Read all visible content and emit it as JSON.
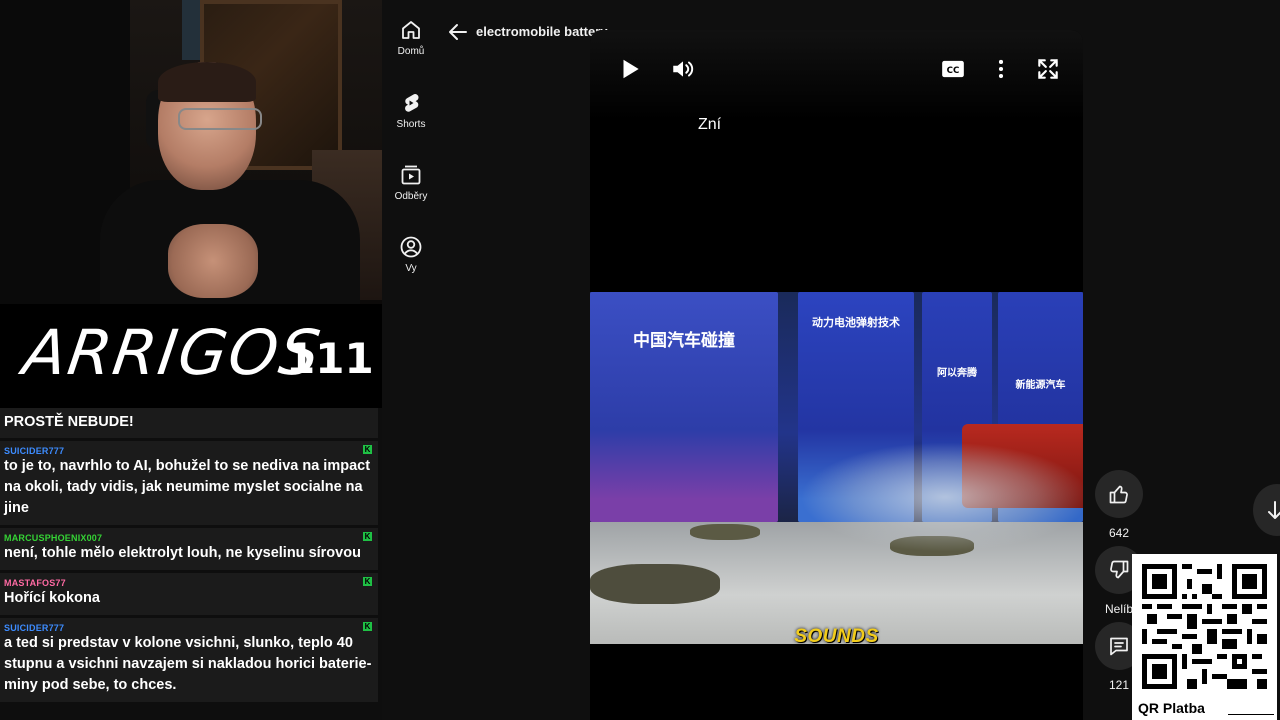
{
  "stream": {
    "brand_name": "ARRIGOS",
    "viewer_count": "111"
  },
  "chat": {
    "partial_message": "PROSTĚ NEBUDE!",
    "messages": [
      {
        "user": "SUICIDER777",
        "user_color": "#3d8cff",
        "text": "to je to, navrhlo to AI, bohužel to se nediva na impact na okoli, tady vidis, jak neumime myslet socialne na jine"
      },
      {
        "user": "MARCUSPHOENIX007",
        "user_color": "#35d335",
        "text": "není, tohle mělo elektrolyt louh, ne kyselinu sírovou"
      },
      {
        "user": "MASTAFOS77",
        "user_color": "#ff6aa3",
        "text": "Hořící kokona"
      },
      {
        "user": "SUICIDER777",
        "user_color": "#3d8cff",
        "text": "a ted si predstav v kolone vsichni, slunko, teplo 40 stupnu a vsichni navzajem si nakladou horici baterie-miny pod sebe, to chces."
      }
    ],
    "badge_icon": "kick-badge-icon",
    "badge_color": "#1fc145"
  },
  "youtube": {
    "nav": [
      {
        "label": "Domů",
        "icon": "home-icon"
      },
      {
        "label": "Shorts",
        "icon": "shorts-icon"
      },
      {
        "label": "Odběry",
        "icon": "subscriptions-icon"
      },
      {
        "label": "Vy",
        "icon": "you-icon"
      }
    ],
    "video_title": "electromobile battery...",
    "player": {
      "top_caption": "Zní",
      "subtitle": "SOUNDS",
      "subtitle_color": "#f2cc1b",
      "banners": [
        "中国汽车碰撞",
        "动力电池弹射技术",
        "阿以奔腾",
        "新能源汽车"
      ]
    },
    "actions": {
      "like_count": "642",
      "dislike_label": "Nelíb",
      "comments_count": "121"
    }
  },
  "qr": {
    "label": "QR Platba"
  }
}
